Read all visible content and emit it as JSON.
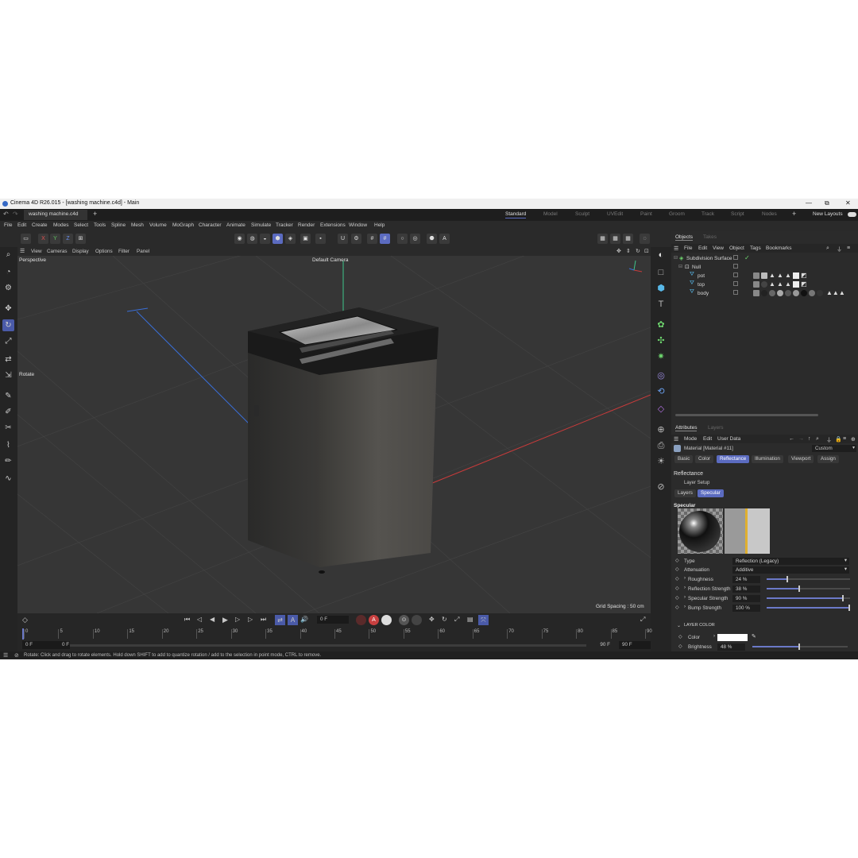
{
  "window": {
    "title": "Cinema 4D R26.015 - [washing machine.c4d] - Main",
    "minimize": "—",
    "maximize": "⧉",
    "close": "✕"
  },
  "tabs": {
    "document": "washing machine.c4d",
    "add": "+",
    "layouts": [
      "Standard",
      "Model",
      "Sculpt",
      "UVEdit",
      "Paint",
      "Groom",
      "Track",
      "Script",
      "Nodes"
    ],
    "active_layout": "Standard",
    "new_layouts": "New Layouts"
  },
  "menu": [
    "File",
    "Edit",
    "Create",
    "Modes",
    "Select",
    "Tools",
    "Spline",
    "Mesh",
    "Volume",
    "MoGraph",
    "Character",
    "Animate",
    "Simulate",
    "Tracker",
    "Render",
    "Extensions",
    "Window",
    "Help"
  ],
  "toolbar": {
    "axis_x": "X",
    "axis_y": "Y",
    "axis_z": "Z"
  },
  "viewport": {
    "menu": [
      "View",
      "Cameras",
      "Display",
      "Options",
      "Filter",
      "Panel"
    ],
    "projection": "Perspective",
    "camera": "Default Camera",
    "tool_label": "Rotate",
    "grid_spacing": "Grid Spacing : 50 cm"
  },
  "timeline": {
    "current_frame": "0 F",
    "ticks": [
      "0",
      "5",
      "10",
      "15",
      "20",
      "25",
      "30",
      "35",
      "40",
      "45",
      "50",
      "55",
      "60",
      "65",
      "70",
      "75",
      "80",
      "85",
      "90"
    ],
    "start": "0 F",
    "start_preview": "0 F",
    "end_preview": "90 F",
    "end": "90 F"
  },
  "objects_panel": {
    "tabs": [
      "Objects",
      "Takes"
    ],
    "menu": [
      "File",
      "Edit",
      "View",
      "Object",
      "Tags",
      "Bookmarks"
    ],
    "rows": [
      {
        "name": "Subdivision Surface",
        "indent": 0
      },
      {
        "name": "Null",
        "indent": 1
      },
      {
        "name": "pot",
        "indent": 2
      },
      {
        "name": "top",
        "indent": 2
      },
      {
        "name": "body",
        "indent": 2
      }
    ]
  },
  "attributes": {
    "tabs": [
      "Attributes",
      "Layers"
    ],
    "menu": [
      "Mode",
      "Edit",
      "User Data"
    ],
    "material": "Material [Material #11]",
    "preset": "Custom",
    "mat_tabs": [
      "Basic",
      "Color",
      "Reflectance",
      "Illumination",
      "Viewport",
      "Assign"
    ],
    "active_mat_tab": "Reflectance",
    "section": "Reflectance",
    "layer_setup": "Layer Setup",
    "layer_tabs": [
      "Layers",
      "Specular"
    ],
    "active_layer_tab": "Specular",
    "specular_heading": "Specular",
    "type_label": "Type",
    "type_value": "Reflection (Legacy)",
    "attenuation_label": "Attenuation",
    "attenuation_value": "Additive",
    "props": [
      {
        "name": "Roughness",
        "value": "24 %",
        "level": 0.24
      },
      {
        "name": "Reflection Strength",
        "value": "38 %",
        "level": 0.38
      },
      {
        "name": "Specular Strength",
        "value": "90 %",
        "level": 0.9
      },
      {
        "name": "Bump Strength",
        "value": "100 %",
        "level": 1.0
      }
    ],
    "layer_color_heading": "LAYER COLOR",
    "color_label": "Color",
    "brightness_label": "Brightness",
    "brightness_value": "48 %",
    "brightness_level": 0.48
  },
  "status": "Rotate: Click and drag to rotate elements. Hold down SHIFT to add to quantize rotation / add to the selection in point mode, CTRL to remove.",
  "colors": {
    "accent": "#5b6bc0",
    "viewport_bg": "#363636",
    "panel_bg": "#2b2b2b"
  }
}
